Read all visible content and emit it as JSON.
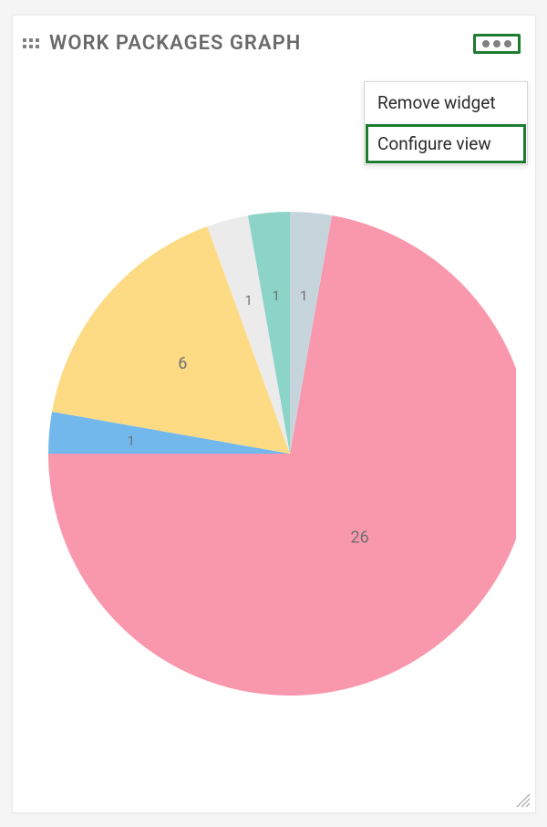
{
  "widget": {
    "title": "WORK PACKAGES GRAPH"
  },
  "menu": {
    "remove_label": "Remove widget",
    "configure_label": "Configure view"
  },
  "chart_data": {
    "type": "pie",
    "title": "",
    "slices": [
      {
        "value": 26,
        "color": "#F998AD"
      },
      {
        "value": 1,
        "color": "#72B8EC"
      },
      {
        "value": 6,
        "color": "#FDDB85"
      },
      {
        "value": 1,
        "color": "#EBEBEB"
      },
      {
        "value": 1,
        "color": "#8CD3C8"
      },
      {
        "value": 1,
        "color": "#C6D5DC"
      }
    ]
  }
}
